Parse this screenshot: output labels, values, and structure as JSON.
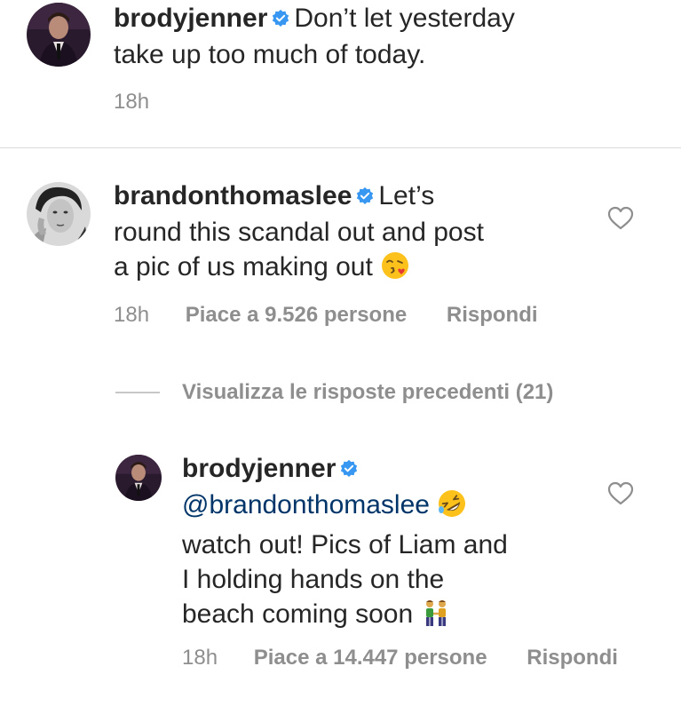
{
  "caption": {
    "username": "brodyjenner",
    "text_line1": "Don’t let yesterday",
    "text_line2": "take up too much of today.",
    "time": "18h"
  },
  "comment": {
    "username": "brandonthomaslee",
    "text_line1": "Let’s",
    "text_line2": "round this scandal out and post",
    "text_line3": "a pic of us making out",
    "time": "18h",
    "likes": "Piace a 9.526 persone",
    "reply": "Rispondi"
  },
  "view_replies": {
    "label": "Visualizza le risposte precedenti (21)"
  },
  "reply": {
    "username": "brodyjenner",
    "mention": "@brandonthomaslee",
    "text_line2": "watch out! Pics of Liam and",
    "text_line3": "I holding hands on the",
    "text_line4": "beach coming soon",
    "time": "18h",
    "likes": "Piace a 14.447 persone",
    "reply": "Rispondi"
  },
  "icons": {
    "verified": "verified-badge-icon",
    "heart": "heart-outline-icon",
    "emoji_kiss": "face-blowing-kiss-emoji",
    "emoji_rofl": "rolling-on-floor-laughing-emoji",
    "emoji_holding_hands": "men-holding-hands-emoji"
  },
  "colors": {
    "text": "#262626",
    "meta": "#8e8e8e",
    "verified": "#3897f0",
    "mention": "#003569",
    "divider": "#dbdbdb"
  }
}
